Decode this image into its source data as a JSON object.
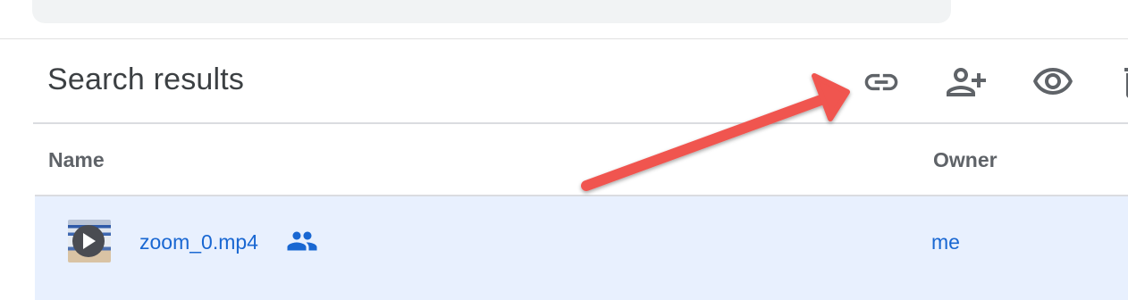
{
  "header": {
    "title": "Search results"
  },
  "toolbar": {
    "actions": [
      {
        "name": "get-link",
        "icon": "link-icon"
      },
      {
        "name": "share",
        "icon": "person-add-icon"
      },
      {
        "name": "preview",
        "icon": "eye-icon"
      },
      {
        "name": "remove",
        "icon": "trash-icon"
      }
    ]
  },
  "table": {
    "columns": [
      "Name",
      "Owner"
    ],
    "rows": [
      {
        "name": "zoom_0.mp4",
        "owner": "me",
        "shared": true,
        "thumbnail_icon": "video-play-icon",
        "selected": true
      }
    ]
  },
  "colors": {
    "accent": "#1967d2",
    "selected_row": "#e8f0fe",
    "annotation_arrow": "#f0544f"
  }
}
